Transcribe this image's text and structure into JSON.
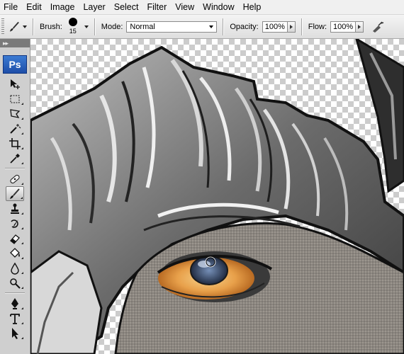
{
  "menu": [
    "File",
    "Edit",
    "Image",
    "Layer",
    "Select",
    "Filter",
    "View",
    "Window",
    "Help"
  ],
  "options_bar": {
    "brush_label": "Brush:",
    "brush_size": "15",
    "mode_label": "Mode:",
    "mode_value": "Normal",
    "opacity_label": "Opacity:",
    "opacity_value": "100%",
    "flow_label": "Flow:",
    "flow_value": "100%"
  },
  "toolbox": {
    "logo": "Ps",
    "active_tool": "brush-tool"
  },
  "colors": {
    "menubar_bg": "#f0f0f0",
    "toolbox_bg": "#cfcfcf",
    "logo_blue": "#2a62c0",
    "iris_orange": "#e8a04a"
  }
}
